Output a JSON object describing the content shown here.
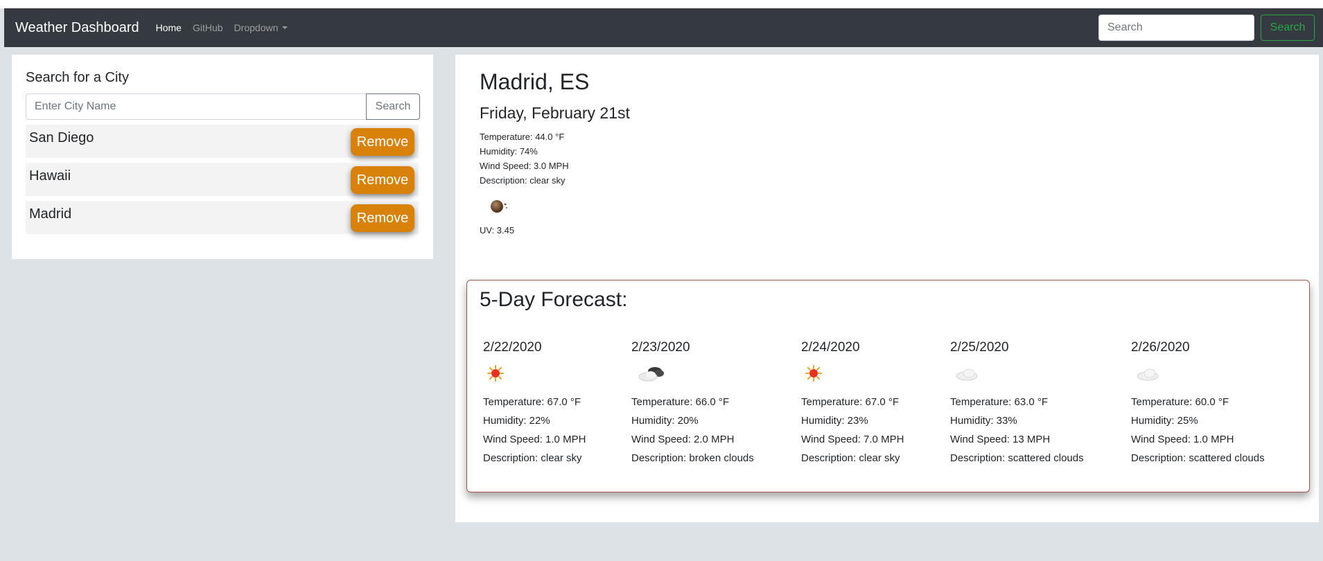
{
  "navbar": {
    "brand": "Weather Dashboard",
    "links": [
      "Home",
      "GitHub",
      "Dropdown"
    ],
    "search_placeholder": "Search",
    "search_button": "Search"
  },
  "sidebar": {
    "title": "Search for a City",
    "input_placeholder": "Enter City Name",
    "search_button": "Search",
    "cities": [
      {
        "name": "San Diego",
        "button": "Remove"
      },
      {
        "name": "Hawaii",
        "button": "Remove"
      },
      {
        "name": "Madrid",
        "button": "Remove"
      }
    ]
  },
  "current": {
    "city": "Madrid, ES",
    "date": "Friday, February 21st",
    "temperature": "Temperature: 44.0 °F",
    "humidity": "Humidity: 74%",
    "wind": "Wind Speed: 3.0 MPH",
    "description": "Description: clear sky",
    "icon": "clear-night-moon-icon",
    "uv": "UV: 3.45"
  },
  "forecast": {
    "title": "5-Day Forecast:",
    "days": [
      {
        "date": "2/22/2020",
        "icon": "sun-icon",
        "temperature": "Temperature: 67.0 °F",
        "humidity": "Humidity: 22%",
        "wind": "Wind Speed: 1.0 MPH",
        "description": "Description: clear sky"
      },
      {
        "date": "2/23/2020",
        "icon": "broken-clouds-icon",
        "temperature": "Temperature: 66.0 °F",
        "humidity": "Humidity: 20%",
        "wind": "Wind Speed: 2.0 MPH",
        "description": "Description: broken clouds"
      },
      {
        "date": "2/24/2020",
        "icon": "sun-icon",
        "temperature": "Temperature: 67.0 °F",
        "humidity": "Humidity: 23%",
        "wind": "Wind Speed: 7.0 MPH",
        "description": "Description: clear sky"
      },
      {
        "date": "2/25/2020",
        "icon": "cloud-icon",
        "temperature": "Temperature: 63.0 °F",
        "humidity": "Humidity: 33%",
        "wind": "Wind Speed: 13 MPH",
        "description": "Description: scattered clouds"
      },
      {
        "date": "2/26/2020",
        "icon": "cloud-icon",
        "temperature": "Temperature: 60.0 °F",
        "humidity": "Humidity: 25%",
        "wind": "Wind Speed: 1.0 MPH",
        "description": "Description: scattered clouds"
      }
    ]
  },
  "colors": {
    "navbar_bg": "#343a40",
    "page_bg": "#dde2e6",
    "remove_button": "#d9820a",
    "nav_search_accent": "#28a745",
    "forecast_border": "#a0584a"
  }
}
